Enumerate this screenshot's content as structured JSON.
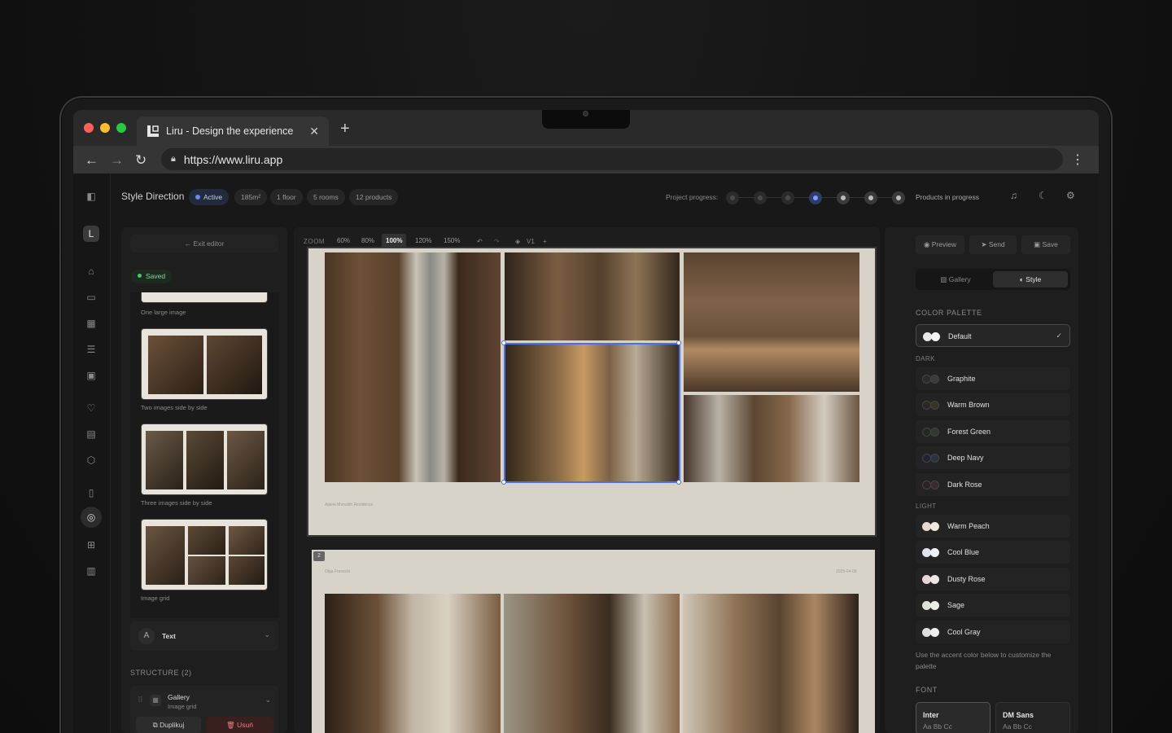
{
  "browser": {
    "tab_title": "Liru - Design the experience",
    "url": "https://www.liru.app"
  },
  "topbar": {
    "title": "Style Direction",
    "status": "Active",
    "chips": [
      "185m²",
      "1 floor",
      "5 rooms",
      "12 products"
    ],
    "progress_label": "Project progress:",
    "progress_status": "Products in progress",
    "progress_steps": 7,
    "progress_current_step": 4
  },
  "left_panel": {
    "exit_label": "Exit editor",
    "saved_label": "Saved",
    "layouts": [
      {
        "caption": "One large image"
      },
      {
        "caption": "Two images side by side"
      },
      {
        "caption": "Three images side by side"
      },
      {
        "caption": "Image grid"
      }
    ],
    "text_row_label": "Text",
    "structure_label": "STRUCTURE (2)",
    "gallery_name": "Gallery",
    "gallery_sub": "Image grid",
    "duplicate_label": "Duplikuj",
    "delete_label": "Usuń"
  },
  "canvas": {
    "zoom_label": "ZOOM",
    "zoom_options": [
      "60%",
      "80%",
      "100%",
      "120%",
      "150%"
    ],
    "zoom_selected": "100%",
    "version_label": "V1",
    "page2_badge": "2",
    "page1_caption": "Alpine Monolith Residence",
    "page2_author": "Olga Franecki",
    "page2_date": "2025-04-08"
  },
  "right_panel": {
    "preview_label": "Preview",
    "send_label": "Send",
    "save_label": "Save",
    "tab_gallery": "Gallery",
    "tab_style": "Style",
    "color_palette_label": "COLOR PALETTE",
    "default_palette": "Default",
    "dark_label": "DARK",
    "dark_palettes": [
      {
        "name": "Graphite",
        "c1": "#2b2b2b",
        "c2": "#3a3a3a"
      },
      {
        "name": "Warm Brown",
        "c1": "#2e2620",
        "c2": "#3a3128"
      },
      {
        "name": "Forest Green",
        "c1": "#222a24",
        "c2": "#2f3a30"
      },
      {
        "name": "Deep Navy",
        "c1": "#1f2430",
        "c2": "#2b3242"
      },
      {
        "name": "Dark Rose",
        "c1": "#2e2225",
        "c2": "#3b2b30"
      }
    ],
    "light_label": "LIGHT",
    "light_palettes": [
      {
        "name": "Warm Peach",
        "c1": "#e8d8cc",
        "c2": "#f1e6dc"
      },
      {
        "name": "Cool Blue",
        "c1": "#dfe4ec",
        "c2": "#eef1f6"
      },
      {
        "name": "Dusty Rose",
        "c1": "#e6d6d6",
        "c2": "#f0e6e6"
      },
      {
        "name": "Sage",
        "c1": "#dce2d6",
        "c2": "#ebefe6"
      },
      {
        "name": "Cool Gray",
        "c1": "#dfdfdf",
        "c2": "#efefef"
      }
    ],
    "hint": "Use the accent color below to customize the palette",
    "font_label": "FONT",
    "fonts": [
      {
        "name": "Inter",
        "sample": "Aa Bb Cc"
      },
      {
        "name": "DM Sans",
        "sample": "Aa Bb Cc"
      }
    ]
  },
  "colors": {
    "accent": "#4a6ff0",
    "active_dot": "#6b88e8",
    "saved_dot": "#4cc46a",
    "delete": "#e58080"
  }
}
